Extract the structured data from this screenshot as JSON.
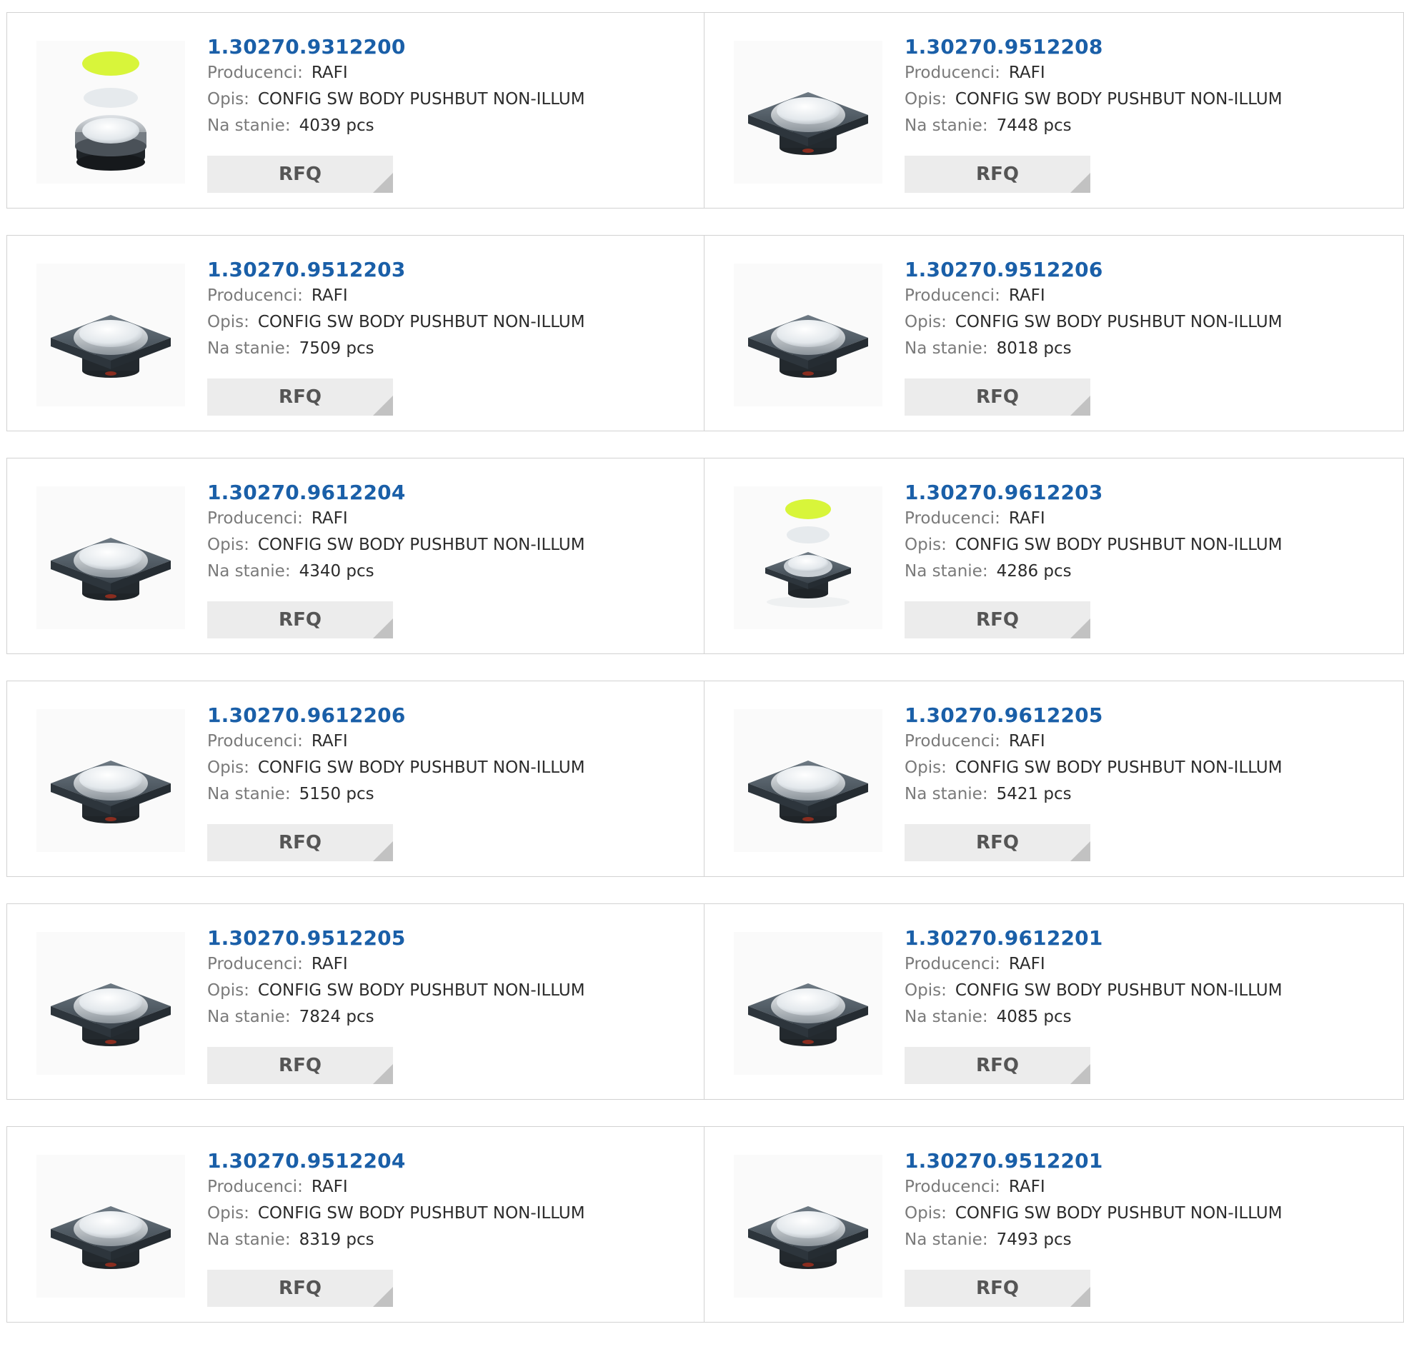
{
  "labels": {
    "manufacturer": "Producenci:",
    "description": "Opis:",
    "stock": "Na stanie:",
    "rfq": "RFQ"
  },
  "colors": {
    "part_link": "#1a5fa8",
    "cap_yellow": "#d8f53a",
    "button_bg": "#ececec"
  },
  "products": [
    {
      "part": "1.30270.9312200",
      "manufacturer": "RAFI",
      "description": "CONFIG SW BODY PUSHBUT NON-ILLUM",
      "stock": "4039 pcs",
      "image": "round-pushbutton-exploded-icon"
    },
    {
      "part": "1.30270.9512208",
      "manufacturer": "RAFI",
      "description": "CONFIG SW BODY PUSHBUT NON-ILLUM",
      "stock": "7448 pcs",
      "image": "square-pushbutton-icon"
    },
    {
      "part": "1.30270.9512203",
      "manufacturer": "RAFI",
      "description": "CONFIG SW BODY PUSHBUT NON-ILLUM",
      "stock": "7509 pcs",
      "image": "square-pushbutton-icon"
    },
    {
      "part": "1.30270.9512206",
      "manufacturer": "RAFI",
      "description": "CONFIG SW BODY PUSHBUT NON-ILLUM",
      "stock": "8018 pcs",
      "image": "square-pushbutton-icon"
    },
    {
      "part": "1.30270.9612204",
      "manufacturer": "RAFI",
      "description": "CONFIG SW BODY PUSHBUT NON-ILLUM",
      "stock": "4340 pcs",
      "image": "square-pushbutton-icon"
    },
    {
      "part": "1.30270.9612203",
      "manufacturer": "RAFI",
      "description": "CONFIG SW BODY PUSHBUT NON-ILLUM",
      "stock": "4286 pcs",
      "image": "square-pushbutton-exploded-icon"
    },
    {
      "part": "1.30270.9612206",
      "manufacturer": "RAFI",
      "description": "CONFIG SW BODY PUSHBUT NON-ILLUM",
      "stock": "5150 pcs",
      "image": "square-pushbutton-icon"
    },
    {
      "part": "1.30270.9612205",
      "manufacturer": "RAFI",
      "description": "CONFIG SW BODY PUSHBUT NON-ILLUM",
      "stock": "5421 pcs",
      "image": "square-pushbutton-icon"
    },
    {
      "part": "1.30270.9512205",
      "manufacturer": "RAFI",
      "description": "CONFIG SW BODY PUSHBUT NON-ILLUM",
      "stock": "7824 pcs",
      "image": "square-pushbutton-icon"
    },
    {
      "part": "1.30270.9612201",
      "manufacturer": "RAFI",
      "description": "CONFIG SW BODY PUSHBUT NON-ILLUM",
      "stock": "4085 pcs",
      "image": "square-pushbutton-icon"
    },
    {
      "part": "1.30270.9512204",
      "manufacturer": "RAFI",
      "description": "CONFIG SW BODY PUSHBUT NON-ILLUM",
      "stock": "8319 pcs",
      "image": "square-pushbutton-icon"
    },
    {
      "part": "1.30270.9512201",
      "manufacturer": "RAFI",
      "description": "CONFIG SW BODY PUSHBUT NON-ILLUM",
      "stock": "7493 pcs",
      "image": "square-pushbutton-icon"
    }
  ]
}
